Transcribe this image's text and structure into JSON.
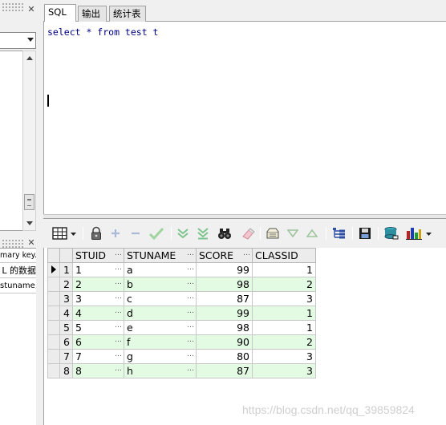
{
  "tabs": [
    {
      "label": "SQL",
      "active": true
    },
    {
      "label": "输出",
      "active": false
    },
    {
      "label": "统计表",
      "active": false
    }
  ],
  "editor": {
    "sql_text": "select * from test t"
  },
  "left_panel": {
    "info_lines": [
      "mary key.",
      "L 的数据",
      "stuname,s"
    ]
  },
  "toolbar": {
    "icons": [
      "grid-select-icon",
      "lock-icon",
      "add-record-icon",
      "delete-record-icon",
      "post-changes-icon",
      "fetch-next-icon",
      "fetch-last-icon",
      "find-icon",
      "clear-icon",
      "query-by-example-icon",
      "previous-icon",
      "next-icon",
      "tree-view-icon",
      "save-icon",
      "export-icon",
      "chart-icon"
    ]
  },
  "grid": {
    "columns": [
      "STUID",
      "STUNAME",
      "SCORE",
      "CLASSID"
    ],
    "rows": [
      {
        "n": "1",
        "STUID": "1",
        "STUNAME": "a",
        "SCORE": "99",
        "CLASSID": "1"
      },
      {
        "n": "2",
        "STUID": "2",
        "STUNAME": "b",
        "SCORE": "98",
        "CLASSID": "2"
      },
      {
        "n": "3",
        "STUID": "3",
        "STUNAME": "c",
        "SCORE": "87",
        "CLASSID": "3"
      },
      {
        "n": "4",
        "STUID": "4",
        "STUNAME": "d",
        "SCORE": "99",
        "CLASSID": "1"
      },
      {
        "n": "5",
        "STUID": "5",
        "STUNAME": "e",
        "SCORE": "98",
        "CLASSID": "1"
      },
      {
        "n": "6",
        "STUID": "6",
        "STUNAME": "f",
        "SCORE": "90",
        "CLASSID": "2"
      },
      {
        "n": "7",
        "STUID": "7",
        "STUNAME": "g",
        "SCORE": "80",
        "CLASSID": "3"
      },
      {
        "n": "8",
        "STUID": "8",
        "STUNAME": "h",
        "SCORE": "87",
        "CLASSID": "3"
      }
    ],
    "current_row": 0,
    "alt_row_color": "#e3fbe3"
  },
  "watermark": "https://blog.csdn.net/qq_39859824"
}
